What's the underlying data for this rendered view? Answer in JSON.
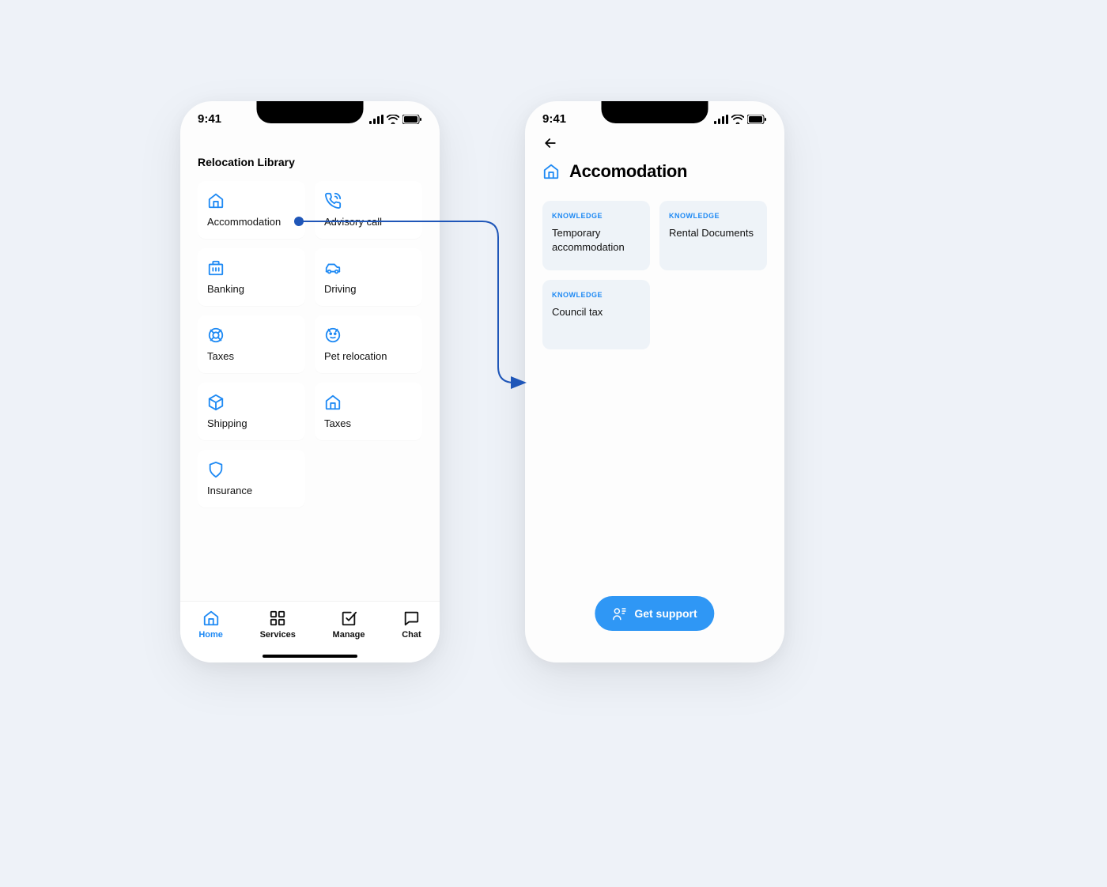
{
  "status_bar": {
    "time": "9:41"
  },
  "colors": {
    "accent": "#1f8af4",
    "bg_page": "#eef2f8",
    "card_soft": "#eef3f8"
  },
  "screen_left": {
    "title": "Relocation Library",
    "categories": [
      {
        "icon": "home-icon",
        "label": "Accommodation"
      },
      {
        "icon": "phone-icon",
        "label": "Advisory call"
      },
      {
        "icon": "bank-icon",
        "label": "Banking"
      },
      {
        "icon": "car-icon",
        "label": "Driving"
      },
      {
        "icon": "buoy-icon",
        "label": "Taxes"
      },
      {
        "icon": "pet-icon",
        "label": "Pet relocation"
      },
      {
        "icon": "box-icon",
        "label": "Shipping"
      },
      {
        "icon": "home-icon",
        "label": "Taxes"
      },
      {
        "icon": "shield-icon",
        "label": "Insurance"
      }
    ],
    "nav": [
      {
        "icon": "home-icon",
        "label": "Home",
        "active": true
      },
      {
        "icon": "grid-icon",
        "label": "Services",
        "active": false
      },
      {
        "icon": "check-icon",
        "label": "Manage",
        "active": false
      },
      {
        "icon": "chat-icon",
        "label": "Chat",
        "active": false
      }
    ]
  },
  "screen_right": {
    "title": "Accomodation",
    "knowledge_tag": "KNOWLEDGE",
    "articles": [
      {
        "title": "Temporary accommodation"
      },
      {
        "title": "Rental Documents"
      },
      {
        "title": "Council tax"
      }
    ],
    "support_button": "Get support"
  }
}
